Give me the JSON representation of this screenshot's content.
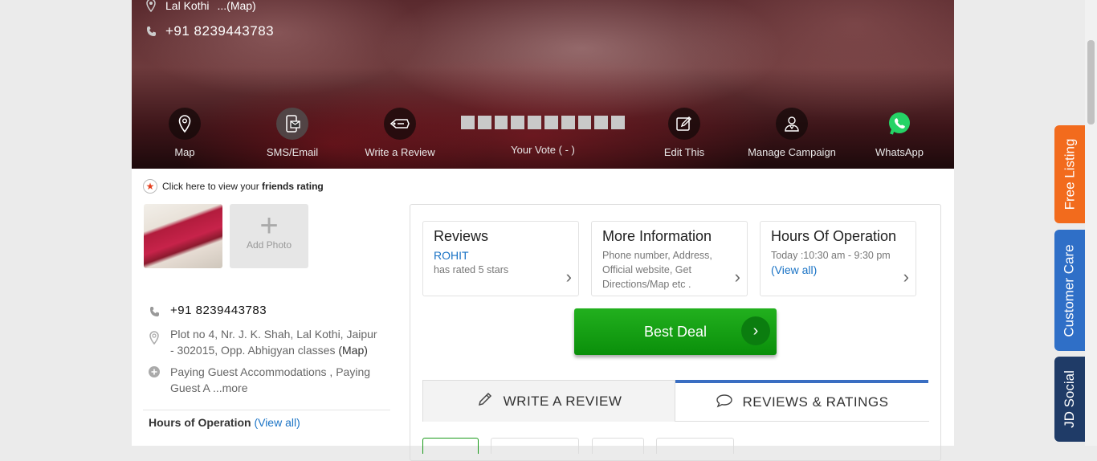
{
  "hero": {
    "address": "Lal Kothi",
    "map_link": "...(Map)",
    "phone": "+91 8239443783"
  },
  "actions": {
    "map": "Map",
    "sms": "SMS/Email",
    "review": "Write a Review",
    "vote": "Your Vote ( - )",
    "edit": "Edit This",
    "campaign": "Manage Campaign",
    "whatsapp": "WhatsApp"
  },
  "friends": {
    "prefix": "Click here to view your ",
    "bold": "friends rating"
  },
  "photos": {
    "add_label": "Add Photo"
  },
  "contact": {
    "phone": "+91 8239443783",
    "address": "Plot no 4, Nr. J. K. Shah, Lal Kothi, Jaipur - 302015, Opp. Abhigyan classes ",
    "address_map": "(Map)",
    "category": "Paying Guest Accommodations , Paying Guest A ",
    "category_more": "...more",
    "hours_label": "Hours of Operation ",
    "hours_link": "(View all)"
  },
  "cards": {
    "reviews": {
      "title": "Reviews",
      "user": "ROHIT",
      "text": "has rated 5 stars"
    },
    "more_info": {
      "title": "More Information",
      "text": "Phone number, Address, Official website, Get Directions/Map etc ."
    },
    "hours": {
      "title": "Hours Of Operation",
      "text": "Today :10:30 am - 9:30 pm",
      "link": "(View all)"
    }
  },
  "best_deal": "Best Deal",
  "tabs": {
    "write": "WRITE A REVIEW",
    "reviews": "REVIEWS & RATINGS"
  },
  "side_tabs": {
    "free": "Free Listing",
    "care": "Customer Care",
    "social": "JD Social"
  },
  "colors": {
    "accent_blue": "#1a73c5",
    "deal_green": "#0a8f0a",
    "free_listing": "#f26b1d",
    "customer_care": "#2f6fc7",
    "jd_social": "#1f3b67"
  }
}
